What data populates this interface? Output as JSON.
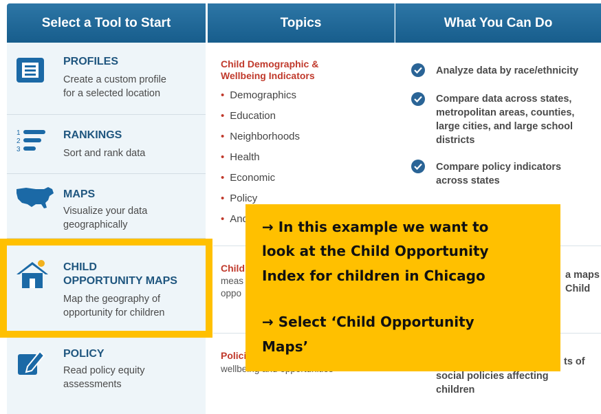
{
  "headers": {
    "tools": "Select a Tool to Start",
    "topics": "Topics",
    "actions": "What You Can Do"
  },
  "tools": [
    {
      "title": "PROFILES",
      "desc1": "Create a custom profile",
      "desc2": "for a selected location",
      "icon": "profile-icon"
    },
    {
      "title": "RANKINGS",
      "desc1": "Sort and rank data",
      "icon": "rankings-icon"
    },
    {
      "title": "MAPS",
      "desc1": "Visualize your data",
      "desc2": "geographically",
      "icon": "us-map-icon"
    },
    {
      "title1": "CHILD",
      "title2": "OPPORTUNITY MAPS",
      "desc1": "Map the geography of",
      "desc2": "opportunity for children",
      "icon": "house-icon"
    },
    {
      "title": "POLICY",
      "desc1": "Read policy equity",
      "desc2": "assessments",
      "icon": "policy-edit-icon"
    }
  ],
  "topics": {
    "block1": {
      "head1": "Child Demographic &",
      "head2": "Wellbeing Indicators",
      "items": [
        "Demographics",
        "Education",
        "Neighborhoods",
        "Health",
        "Economic",
        "Policy",
        "And"
      ]
    },
    "block2": {
      "head": "Child",
      "line1": "meas",
      "line2": "oppo"
    },
    "block3": {
      "head": "Polici",
      "line1": "wellbeing and opportunities"
    }
  },
  "actions": {
    "a1": "Analyze data by race/ethnicity",
    "a2": [
      "Compare data across states,",
      "metropolitan areas, counties,",
      "large cities, and large school",
      "districts"
    ],
    "a3": [
      "Compare policy indicators",
      "across states"
    ],
    "a4": [
      "a maps",
      "Child"
    ],
    "a5": [
      "ts of",
      "social policies affecting",
      "children"
    ]
  },
  "callout": {
    "line1": "→ In this example we want to",
    "line2": "look at the Child Opportunity",
    "line3": "Index for children in Chicago",
    "line4": "→ Select ‘Child Opportunity",
    "line5": "Maps’"
  },
  "colors": {
    "header": "#1f6a9a",
    "accent_red": "#c0392b",
    "highlight": "#ffc000",
    "tool_title": "#1f567f"
  }
}
